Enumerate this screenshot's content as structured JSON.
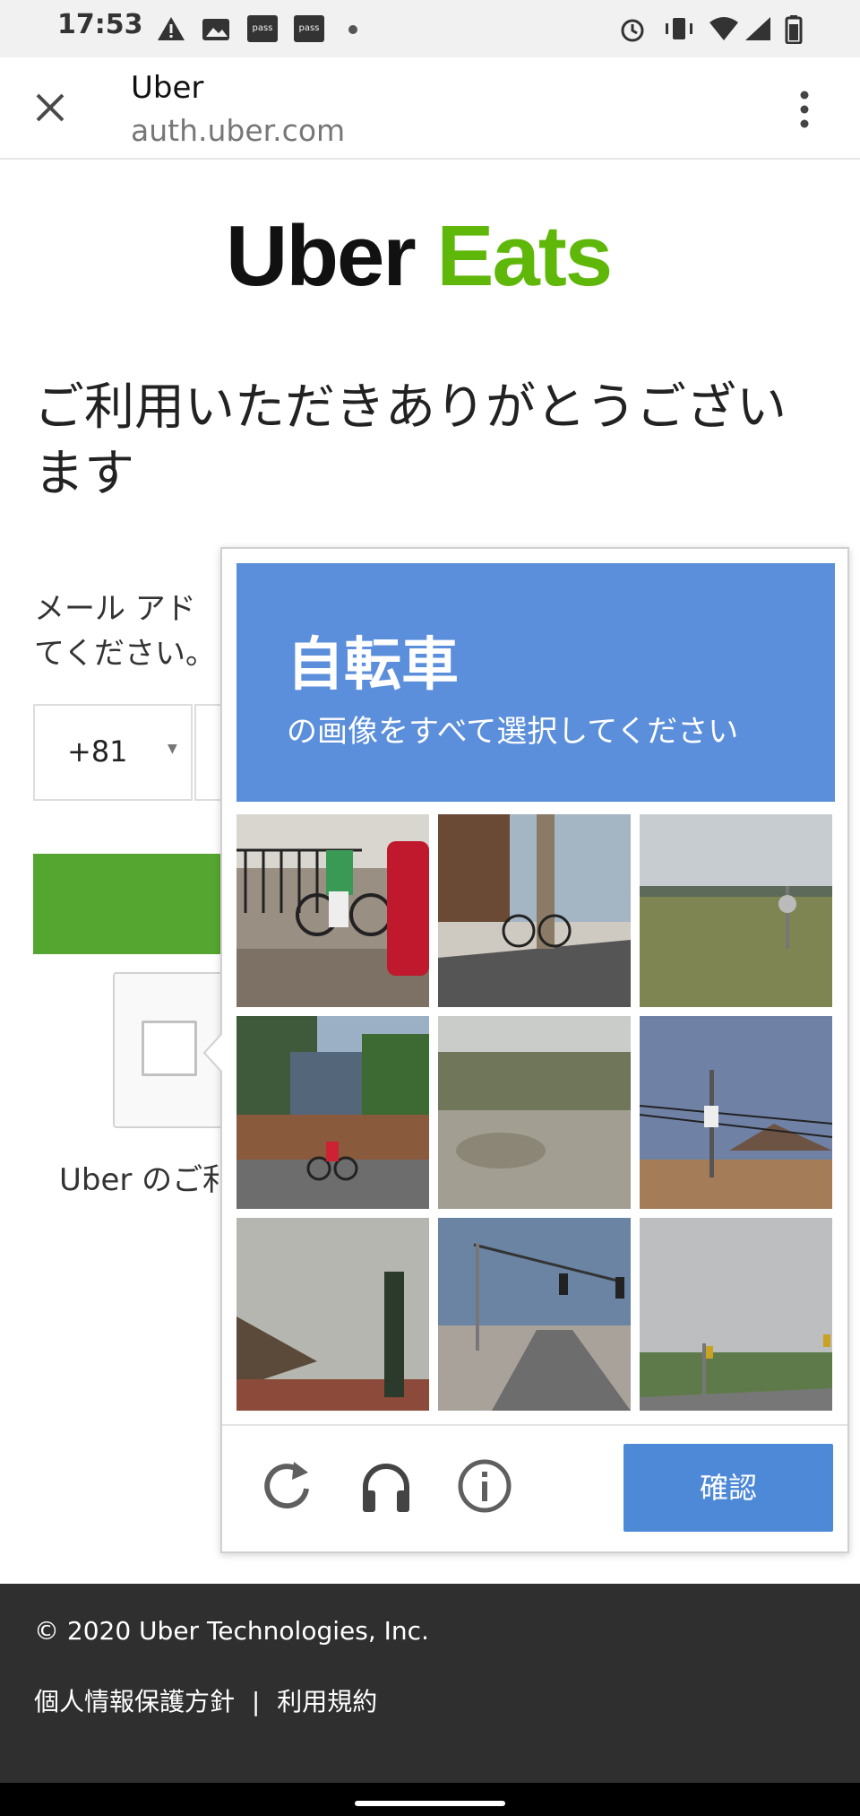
{
  "status_bar": {
    "time": "17:53",
    "icons_left": [
      "warning-icon",
      "gallery-icon",
      "pass-icon",
      "pass-icon",
      "dot-icon"
    ],
    "pass_label": "pass",
    "icons_right": [
      "alarm-icon",
      "vibrate-icon",
      "wifi-icon",
      "signal-icon",
      "battery-icon"
    ]
  },
  "browser_header": {
    "title": "Uber",
    "url": "auth.uber.com",
    "close_icon": "close-icon",
    "menu_icon": "more-vert-icon"
  },
  "page": {
    "logo_uber": "Uber",
    "logo_eats": "Eats",
    "heading": "ご利用いただきありがとうございます",
    "prompt_line1": "メール アド",
    "prompt_line2": "てください。",
    "country_code": "+81",
    "uber_line": "Uber のご利"
  },
  "captcha": {
    "target_word": "自転車",
    "instruction": "の画像をすべて選択してください",
    "verify_label": "確認",
    "tiles": [
      "bicycle-rider-tile",
      "bicycle-tree-tile",
      "field-tile",
      "house-cyclist-tile",
      "empty-lot-tile",
      "sign-pole-tile",
      "roof-tile",
      "traffic-light-tile",
      "road-tile"
    ],
    "tools": [
      "reload-icon",
      "audio-icon",
      "info-icon"
    ]
  },
  "footer": {
    "copyright": "© 2020 Uber Technologies, Inc.",
    "privacy": "個人情報保護方針",
    "separator": "|",
    "terms": "利用規約"
  },
  "colors": {
    "eats_green": "#5fb709",
    "captcha_blue": "#5b8edb",
    "verify_blue": "#4e89d8",
    "footer_bg": "#2f2f2f"
  }
}
